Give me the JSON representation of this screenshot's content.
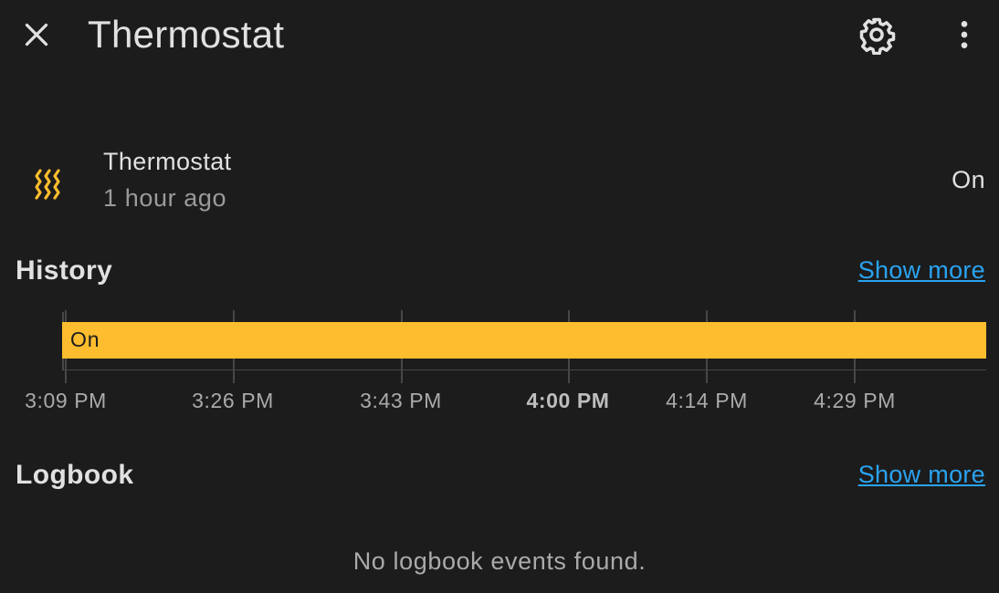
{
  "header": {
    "title": "Thermostat",
    "close_icon": "close-icon",
    "settings_icon": "gear-icon",
    "more_icon": "dots-vertical-icon"
  },
  "entity": {
    "name": "Thermostat",
    "last_changed": "1 hour ago",
    "state": "On",
    "icon": "heat-waves-icon",
    "icon_color": "#fdbd2e"
  },
  "history": {
    "title": "History",
    "show_more": "Show more",
    "bar_label": "On",
    "bar_color": "#fdbd2e",
    "ticks": [
      {
        "label": "3:09 PM",
        "major": false
      },
      {
        "label": "3:26 PM",
        "major": false
      },
      {
        "label": "3:43 PM",
        "major": false
      },
      {
        "label": "4:00 PM",
        "major": true
      },
      {
        "label": "4:14 PM",
        "major": false
      },
      {
        "label": "4:29 PM",
        "major": false
      }
    ]
  },
  "logbook": {
    "title": "Logbook",
    "show_more": "Show more",
    "empty_message": "No logbook events found."
  },
  "colors": {
    "background": "#1c1c1c",
    "link": "#2aa3f0",
    "text": "#e1e1e1"
  }
}
